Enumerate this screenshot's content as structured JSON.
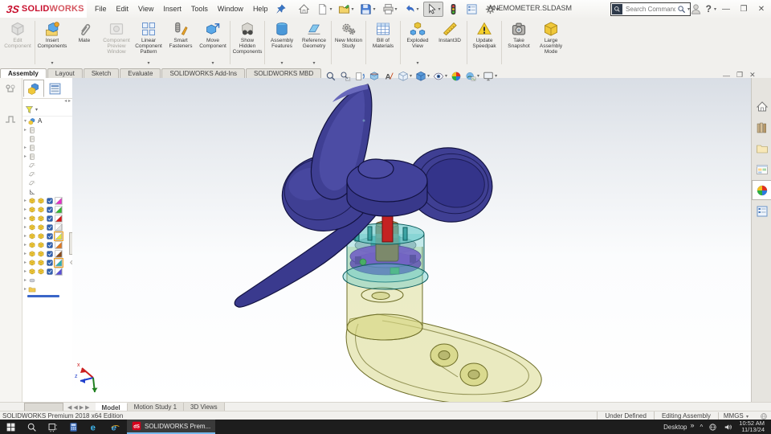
{
  "titlebar": {
    "logo_swirl": "3S",
    "logo_bold": "SOLID",
    "logo_light": "WORKS",
    "menus": [
      "File",
      "Edit",
      "View",
      "Insert",
      "Tools",
      "Window",
      "Help"
    ],
    "quick_access": [
      {
        "name": "home-icon",
        "dropdown": false
      },
      {
        "name": "new-document-icon",
        "dropdown": true
      },
      {
        "name": "open-icon",
        "dropdown": true
      },
      {
        "name": "save-icon",
        "dropdown": true
      },
      {
        "name": "print-icon",
        "dropdown": true
      },
      {
        "name": "undo-icon",
        "dropdown": true
      },
      {
        "name": "select-icon",
        "dropdown": true,
        "active": true
      },
      {
        "name": "rebuild-icon",
        "dropdown": false
      },
      {
        "name": "options-list-icon",
        "dropdown": false
      },
      {
        "name": "settings-icon",
        "dropdown": true
      }
    ],
    "title": "ANEMOMETER.SLDASM",
    "search_placeholder": "Search Commands",
    "help_glyph": "?"
  },
  "ribbon": {
    "groups": [
      [
        {
          "label": "Edit Component",
          "icon": "edit-component",
          "enabled": false,
          "dropdown": false
        }
      ],
      [
        {
          "label": "Insert Components",
          "icon": "insert-components",
          "enabled": true,
          "dropdown": true
        },
        {
          "label": "Mate",
          "icon": "mate",
          "enabled": true,
          "dropdown": false
        },
        {
          "label": "Component Preview Window",
          "icon": "preview-window",
          "enabled": false,
          "dropdown": false
        },
        {
          "label": "Linear Component Pattern",
          "icon": "linear-pattern",
          "enabled": true,
          "dropdown": true
        },
        {
          "label": "Smart Fasteners",
          "icon": "smart-fasteners",
          "enabled": true,
          "dropdown": false
        },
        {
          "label": "Move Component",
          "icon": "move-component",
          "enabled": true,
          "dropdown": true
        }
      ],
      [
        {
          "label": "Show Hidden Components",
          "icon": "show-hidden",
          "enabled": true,
          "dropdown": false
        }
      ],
      [
        {
          "label": "Assembly Features",
          "icon": "assembly-features",
          "enabled": true,
          "dropdown": true
        },
        {
          "label": "Reference Geometry",
          "icon": "reference-geometry",
          "enabled": true,
          "dropdown": true
        }
      ],
      [
        {
          "label": "New Motion Study",
          "icon": "motion-study",
          "enabled": true,
          "dropdown": false
        }
      ],
      [
        {
          "label": "Bill of Materials",
          "icon": "bom",
          "enabled": true,
          "dropdown": false
        }
      ],
      [
        {
          "label": "Exploded View",
          "icon": "exploded-view",
          "enabled": true,
          "dropdown": true
        },
        {
          "label": "Instant3D",
          "icon": "instant3d",
          "enabled": true,
          "dropdown": false
        }
      ],
      [
        {
          "label": "Update Speedpak",
          "icon": "speedpak",
          "enabled": true,
          "dropdown": false
        }
      ],
      [
        {
          "label": "Take Snapshot",
          "icon": "snapshot",
          "enabled": true,
          "dropdown": false
        },
        {
          "label": "Large Assembly Mode",
          "icon": "large-assembly",
          "enabled": true,
          "dropdown": false
        }
      ]
    ]
  },
  "command_tabs": [
    {
      "label": "Assembly",
      "active": true
    },
    {
      "label": "Layout",
      "active": false
    },
    {
      "label": "Sketch",
      "active": false
    },
    {
      "label": "Evaluate",
      "active": false
    },
    {
      "label": "SOLIDWORKS Add-Ins",
      "active": false
    },
    {
      "label": "SOLIDWORKS MBD",
      "active": false
    }
  ],
  "headsup": [
    {
      "name": "zoom-fit-icon",
      "dropdown": false
    },
    {
      "name": "zoom-area-icon",
      "dropdown": false
    },
    {
      "name": "previous-view-icon",
      "dropdown": false
    },
    {
      "name": "section-view-icon",
      "dropdown": false
    },
    {
      "name": "annotations-icon",
      "dropdown": false
    },
    {
      "name": "view-orientation-icon",
      "dropdown": true
    },
    {
      "name": "display-style-icon",
      "dropdown": true
    },
    {
      "name": "hide-show-items-icon",
      "dropdown": true
    },
    {
      "name": "edit-appearance-icon",
      "dropdown": false
    },
    {
      "name": "apply-scene-icon",
      "dropdown": true
    },
    {
      "name": "view-settings-icon",
      "dropdown": true
    }
  ],
  "left_strip": [
    "component-flyout-icon",
    "sketch-step-icon"
  ],
  "feature_tree": {
    "root_label": "A",
    "rows": [
      {
        "t": "root",
        "label": "A"
      },
      {
        "t": "item",
        "arrow": true,
        "icon": "book"
      },
      {
        "t": "item",
        "arrow": false,
        "icon": "book"
      },
      {
        "t": "item",
        "arrow": true,
        "icon": "book"
      },
      {
        "t": "item",
        "arrow": true,
        "icon": "book"
      },
      {
        "t": "item",
        "arrow": false,
        "icon": "planes"
      },
      {
        "t": "item",
        "arrow": false,
        "icon": "planes"
      },
      {
        "t": "item",
        "arrow": false,
        "icon": "planes"
      },
      {
        "t": "item",
        "arrow": false,
        "icon": "origin"
      },
      {
        "t": "comp",
        "swatch": "#e62ec8",
        "eye": false,
        "hl": false
      },
      {
        "t": "comp",
        "swatch": "#2eb82e",
        "eye": false,
        "hl": false
      },
      {
        "t": "comp",
        "swatch": "#d81616",
        "eye": false,
        "hl": false
      },
      {
        "t": "comp",
        "swatch": "#e2e2e2",
        "eye": false,
        "hl": false
      },
      {
        "t": "comp",
        "swatch": "#e8e83a",
        "eye": true,
        "hl": true
      },
      {
        "t": "comp",
        "swatch": "#e07820",
        "eye": false,
        "hl": false
      },
      {
        "t": "comp",
        "swatch": "#8a4a1a",
        "eye": false,
        "hl": false
      },
      {
        "t": "comp",
        "swatch": "#28b0b0",
        "eye": true,
        "hl": true
      },
      {
        "t": "comp",
        "swatch": "#5a50d8",
        "eye": false,
        "hl": false
      },
      {
        "t": "item",
        "arrow": true,
        "icon": "capsule"
      },
      {
        "t": "item",
        "arrow": true,
        "icon": "folder-y"
      }
    ]
  },
  "taskpane": [
    {
      "name": "home-icon",
      "active": false
    },
    {
      "name": "design-library-icon",
      "active": false
    },
    {
      "name": "file-explorer-icon",
      "active": false
    },
    {
      "name": "view-palette-icon",
      "active": false
    },
    {
      "name": "appearances-icon",
      "active": true
    },
    {
      "name": "custom-properties-icon",
      "active": false
    }
  ],
  "model": {
    "name": "anemometer assembly",
    "cup_color": "#3f3f93",
    "cup_dark": "#2a2a70",
    "cup_light": "#5353a8",
    "outline": "#121240",
    "shaft_color": "#c42222",
    "bushing_color": "#8a683a",
    "housing_teal": "#60c8c8",
    "gear_purple": "#7d2ec2",
    "green_part": "#3da02e",
    "base_yellow": "#d6d682",
    "base_edge": "#6e6e28"
  },
  "bottom_tabs": [
    {
      "label": "Model",
      "active": true
    },
    {
      "label": "Motion Study 1",
      "active": false
    },
    {
      "label": "3D Views",
      "active": false
    }
  ],
  "statusbar": {
    "left": "SOLIDWORKS Premium 2018 x64 Edition",
    "cells": [
      "Under Defined",
      "Editing Assembly"
    ],
    "units": "MMGS"
  },
  "taskbar": {
    "apps": [
      "start-icon",
      "search-icon",
      "task-view-icon",
      "calculator-app-icon",
      "edge-icon",
      "internet-explorer-icon"
    ],
    "active_task": "SOLIDWORKS Prem...",
    "tray": {
      "desktop_label": "Desktop",
      "overflow": "»",
      "caret": "^",
      "time": "10:52 AM",
      "date": "11/13/24"
    }
  }
}
